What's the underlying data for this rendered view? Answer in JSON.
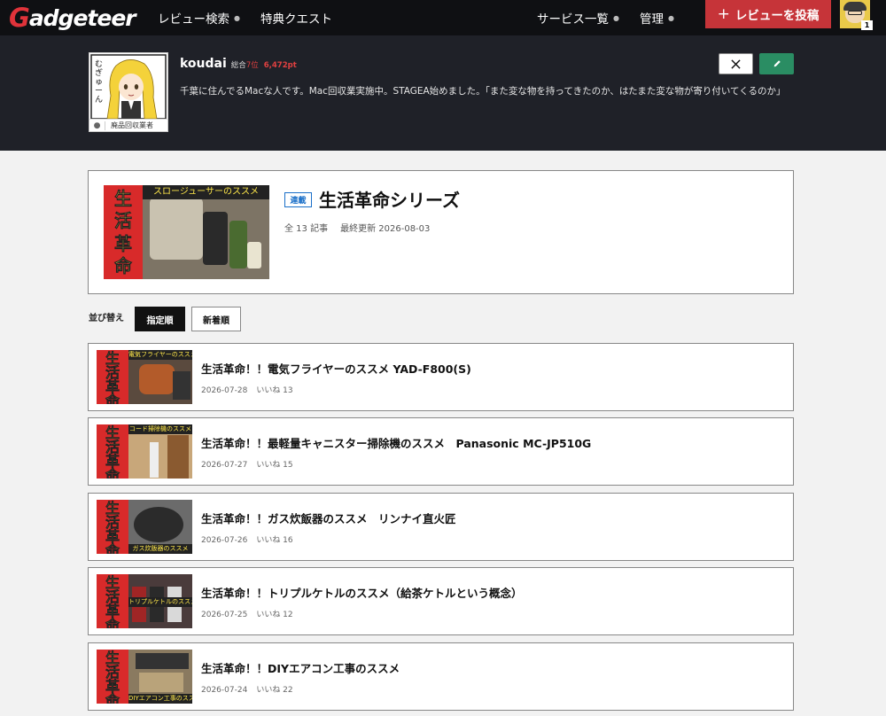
{
  "header": {
    "logo": "Gadgeteer",
    "nav": [
      {
        "label": "レビュー検索"
      },
      {
        "label": "特典クエスト"
      },
      {
        "label": "サービス一覧"
      },
      {
        "label": "管理"
      }
    ],
    "post_button": "レビューを投稿",
    "notification_count": "1"
  },
  "profile": {
    "name": "koudai",
    "rank_prefix": "総合",
    "rank": "7位",
    "points": "6,472pt",
    "bio": "千葉に住んでるMacな人です。Mac回収業実施中。STAGEA始めました。「また変な物を持ってきたのか、はたまた変な物が寄り付いてくるのか」",
    "badge_label": "廃品回収業者",
    "avatar_text": "むぎゅーん"
  },
  "series": {
    "tag": "連載",
    "title": "生活革命シリーズ",
    "count": "全 13 記事",
    "updated": "最終更新 2026-08-03",
    "thumb_banner": "スロージューサーのススメ",
    "thumb_kanji": [
      "生",
      "活",
      "革",
      "命"
    ]
  },
  "sort": {
    "label": "並び替え",
    "options": [
      "指定順",
      "新着順"
    ],
    "active": "指定順"
  },
  "articles": [
    {
      "title": "生活革命！！電気フライヤーのススメ YAD-F800(S)",
      "date": "2026-07-28",
      "likes": "いいね 13",
      "banner": "電気フライヤーのススメ"
    },
    {
      "title": "生活革命！！最軽量キャニスター掃除機のススメ　Panasonic MC-JP510G",
      "date": "2026-07-27",
      "likes": "いいね 15",
      "banner": "コード掃除機のススメ"
    },
    {
      "title": "生活革命！！ガス炊飯器のススメ　リンナイ直火匠",
      "date": "2026-07-26",
      "likes": "いいね 16",
      "banner": "ガス炊飯器のススメ"
    },
    {
      "title": "生活革命！！トリプルケトルのススメ（給茶ケトルという概念）",
      "date": "2026-07-25",
      "likes": "いいね 12",
      "banner": "トリプルケトルのススメ"
    },
    {
      "title": "生活革命！！DIYエアコン工事のススメ",
      "date": "2026-07-24",
      "likes": "いいね 22",
      "banner": "DIYエアコン工事のススメ"
    }
  ],
  "colors": {
    "accent": "#c63439",
    "edit": "#2a8d63",
    "tag": "#1a6fc8",
    "header_bg": "#0f1013",
    "profile_bg": "#1f2128"
  },
  "icons": {
    "x_share": "x-icon",
    "edit": "pencil-icon",
    "apple": "apple-icon"
  }
}
